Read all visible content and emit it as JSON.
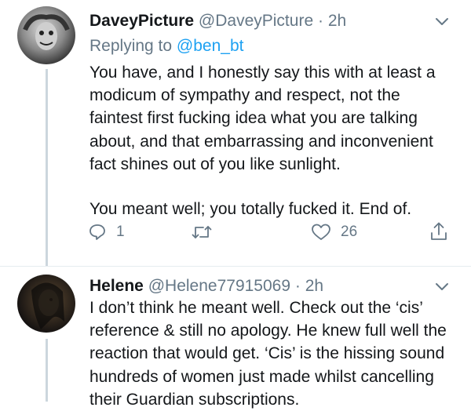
{
  "tweets": [
    {
      "display_name": "DaveyPicture",
      "handle": "@DaveyPicture",
      "separator": "·",
      "time": "2h",
      "replying_label": "Replying to",
      "replying_handle": "@ben_bt",
      "body_lines": [
        "You have, and I honestly say this with at least a modicum of sympathy and respect, not the faintest first fucking idea what you are talking about, and that embarrassing and inconvenient fact shines out of you like sunlight.",
        "You meant well; you totally fucked it. End of."
      ],
      "reply_count": "1",
      "retweet_count": "",
      "like_count": "26"
    },
    {
      "display_name": "Helene",
      "handle": "@Helene77915069",
      "separator": "·",
      "time": "2h",
      "body_lines": [
        "I don’t think he meant well. Check out the ‘cis’ reference & still no apology. He knew full well the reaction that would get. ‘Cis’ is the hissing sound hundreds of women just made whilst cancelling their Guardian subscriptions."
      ]
    }
  ],
  "icons": {
    "reply": "reply-icon",
    "retweet": "retweet-icon",
    "like": "heart-icon",
    "share": "share-icon",
    "menu": "chevron-down-icon"
  },
  "colors": {
    "text": "#14171a",
    "secondary": "#657786",
    "link": "#1da1f2",
    "thread_line": "#ccd6dd"
  }
}
